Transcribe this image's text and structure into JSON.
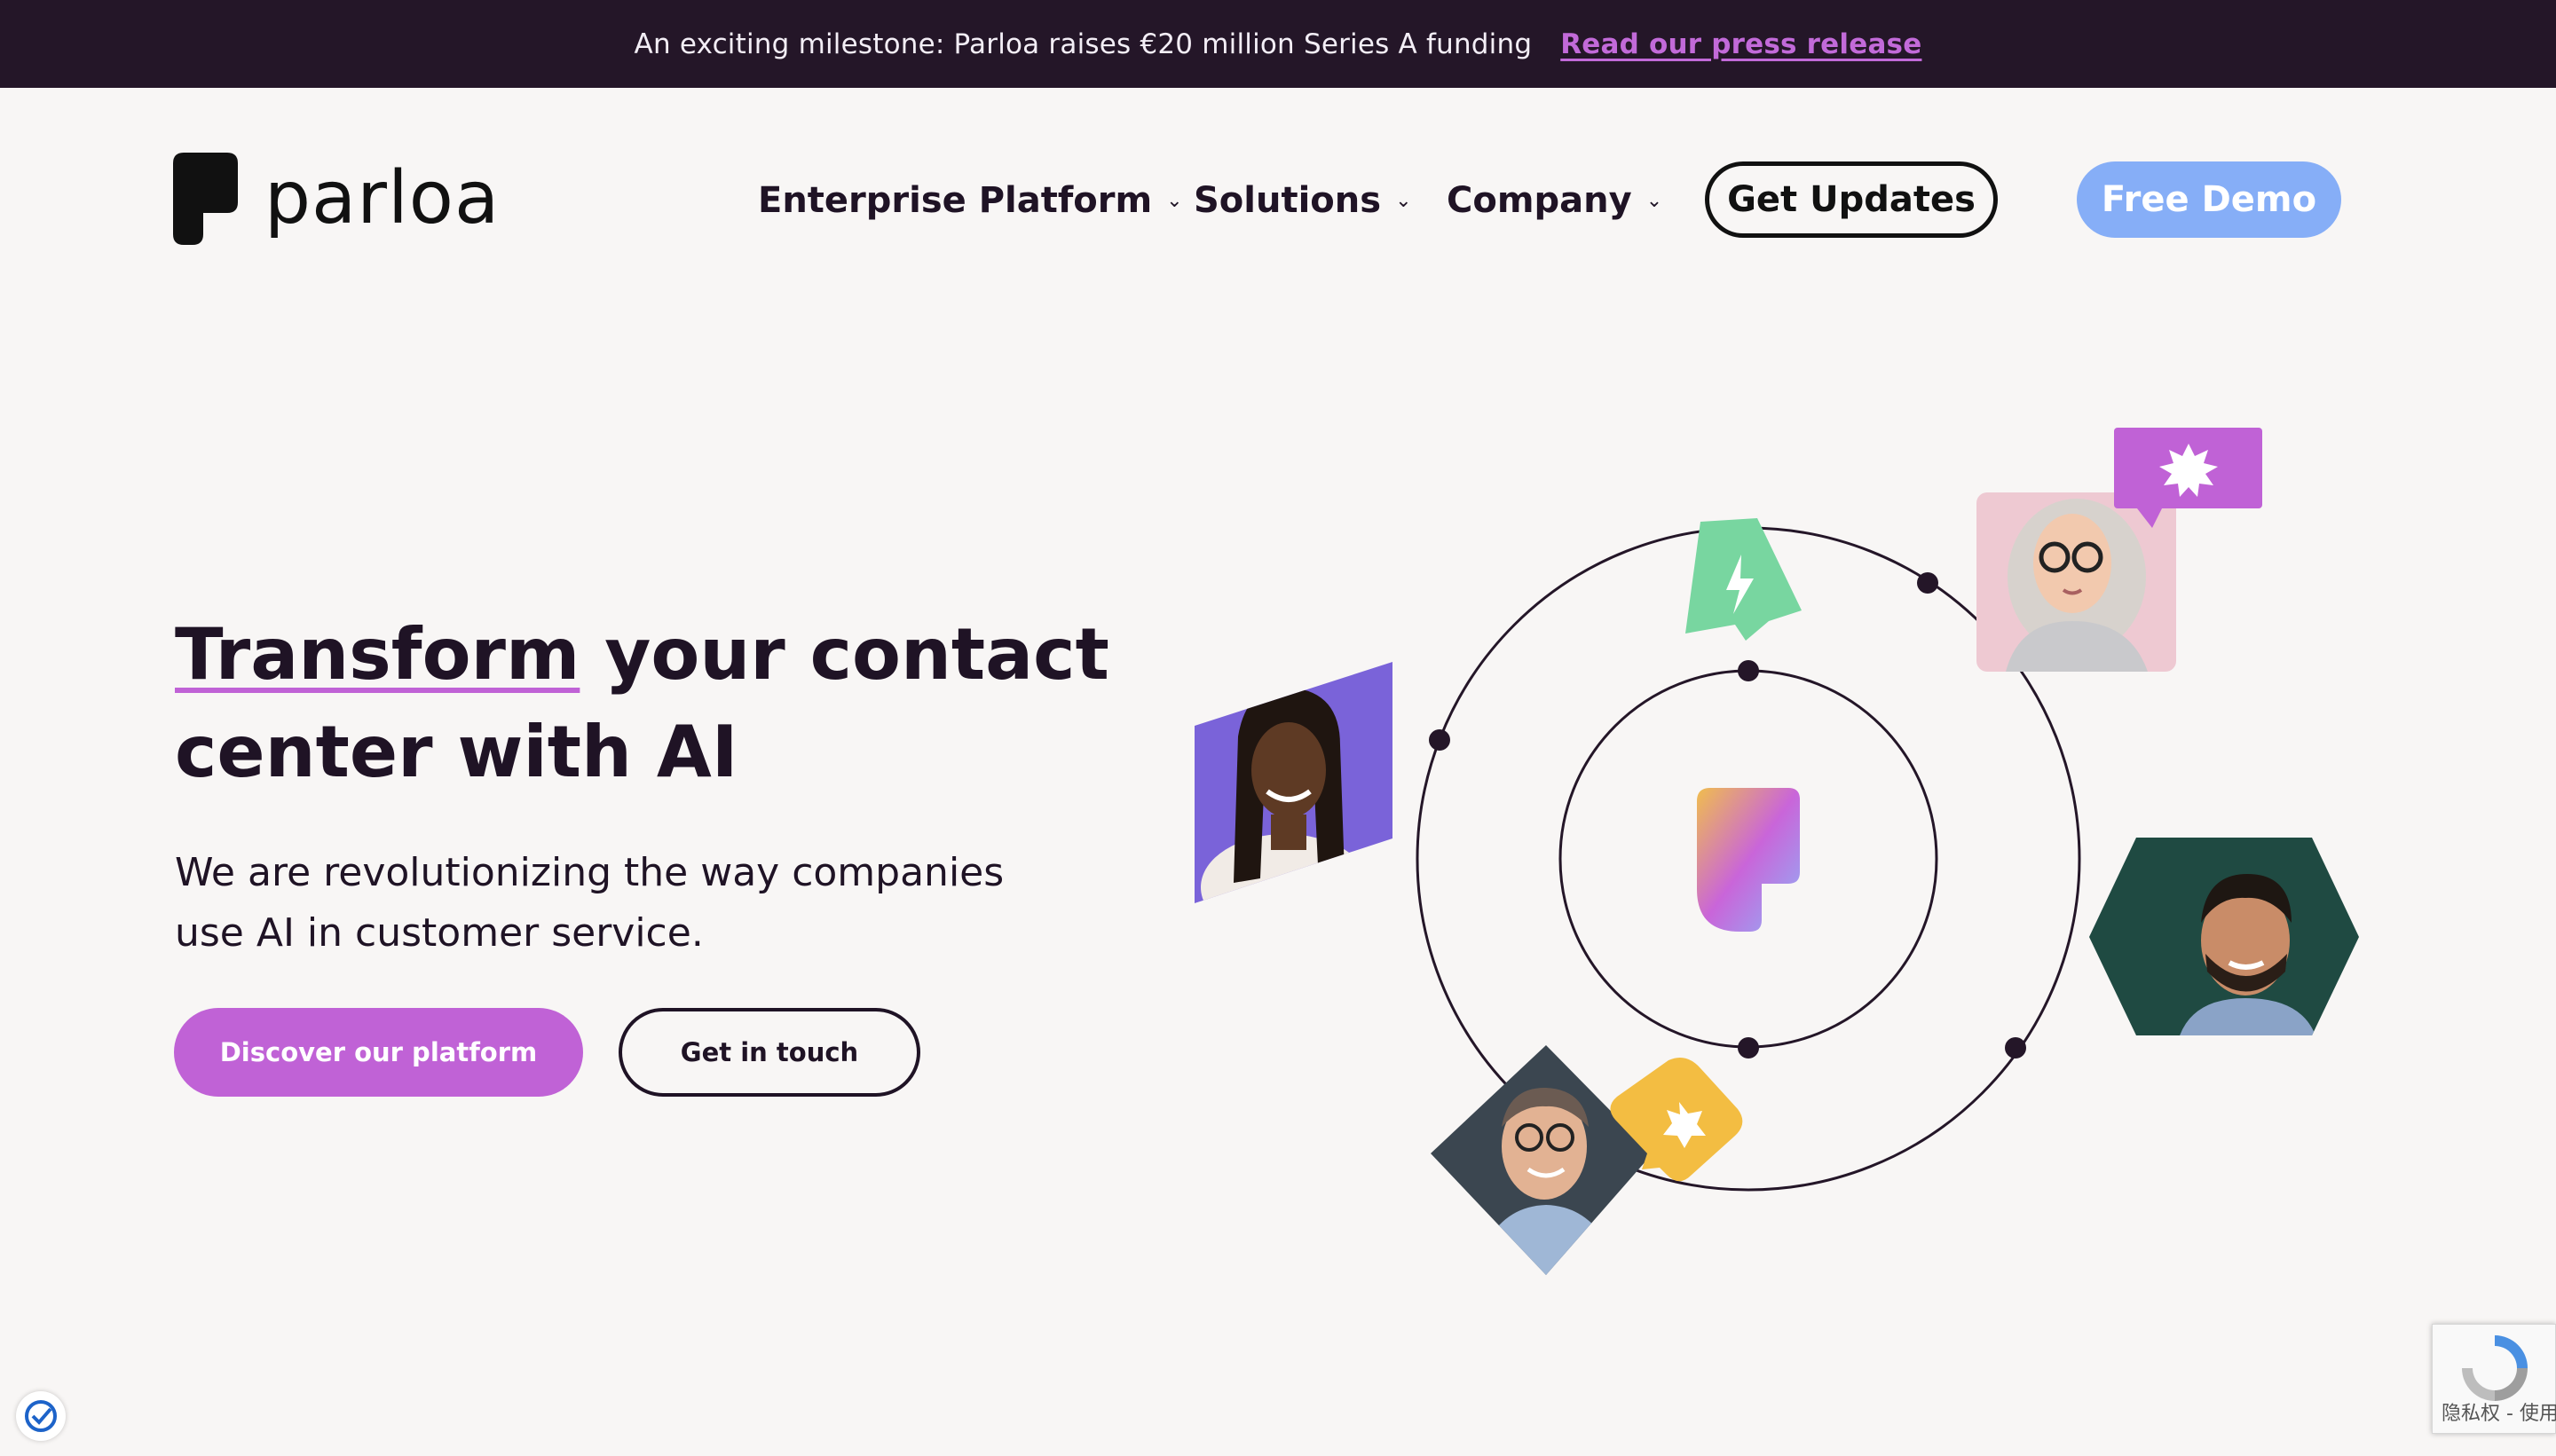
{
  "banner": {
    "text": "An exciting milestone: Parloa raises €20 million Series A funding",
    "link_label": "Read our press release"
  },
  "brand": {
    "name": "parloa"
  },
  "nav": {
    "items": [
      {
        "label": "Enterprise Platform",
        "icon": "chevron-down-icon"
      },
      {
        "label": "Solutions",
        "icon": "chevron-down-icon"
      },
      {
        "label": "Company",
        "icon": "chevron-down-icon"
      }
    ],
    "updates_label": "Get Updates",
    "demo_label": "Free Demo"
  },
  "hero": {
    "title_highlight": "Transform",
    "title_rest": " your contact center with AI",
    "subtitle": "We are revolutionizing the way companies use AI in customer service.",
    "primary_cta": "Discover our platform",
    "secondary_cta": "Get in touch"
  },
  "recaptcha": {
    "text": "隐私权 - 使用条款",
    "icon": "recaptcha-icon"
  },
  "cookie": {
    "icon": "cookie-consent-icon"
  },
  "colors": {
    "banner_bg": "#241628",
    "accent_purple": "#c062d6",
    "demo_blue": "#86aef7",
    "background": "#f8f6f5",
    "text_dark": "#1f1325",
    "green_bubble": "#78d6a0",
    "yellow_bubble": "#f3bd42"
  }
}
